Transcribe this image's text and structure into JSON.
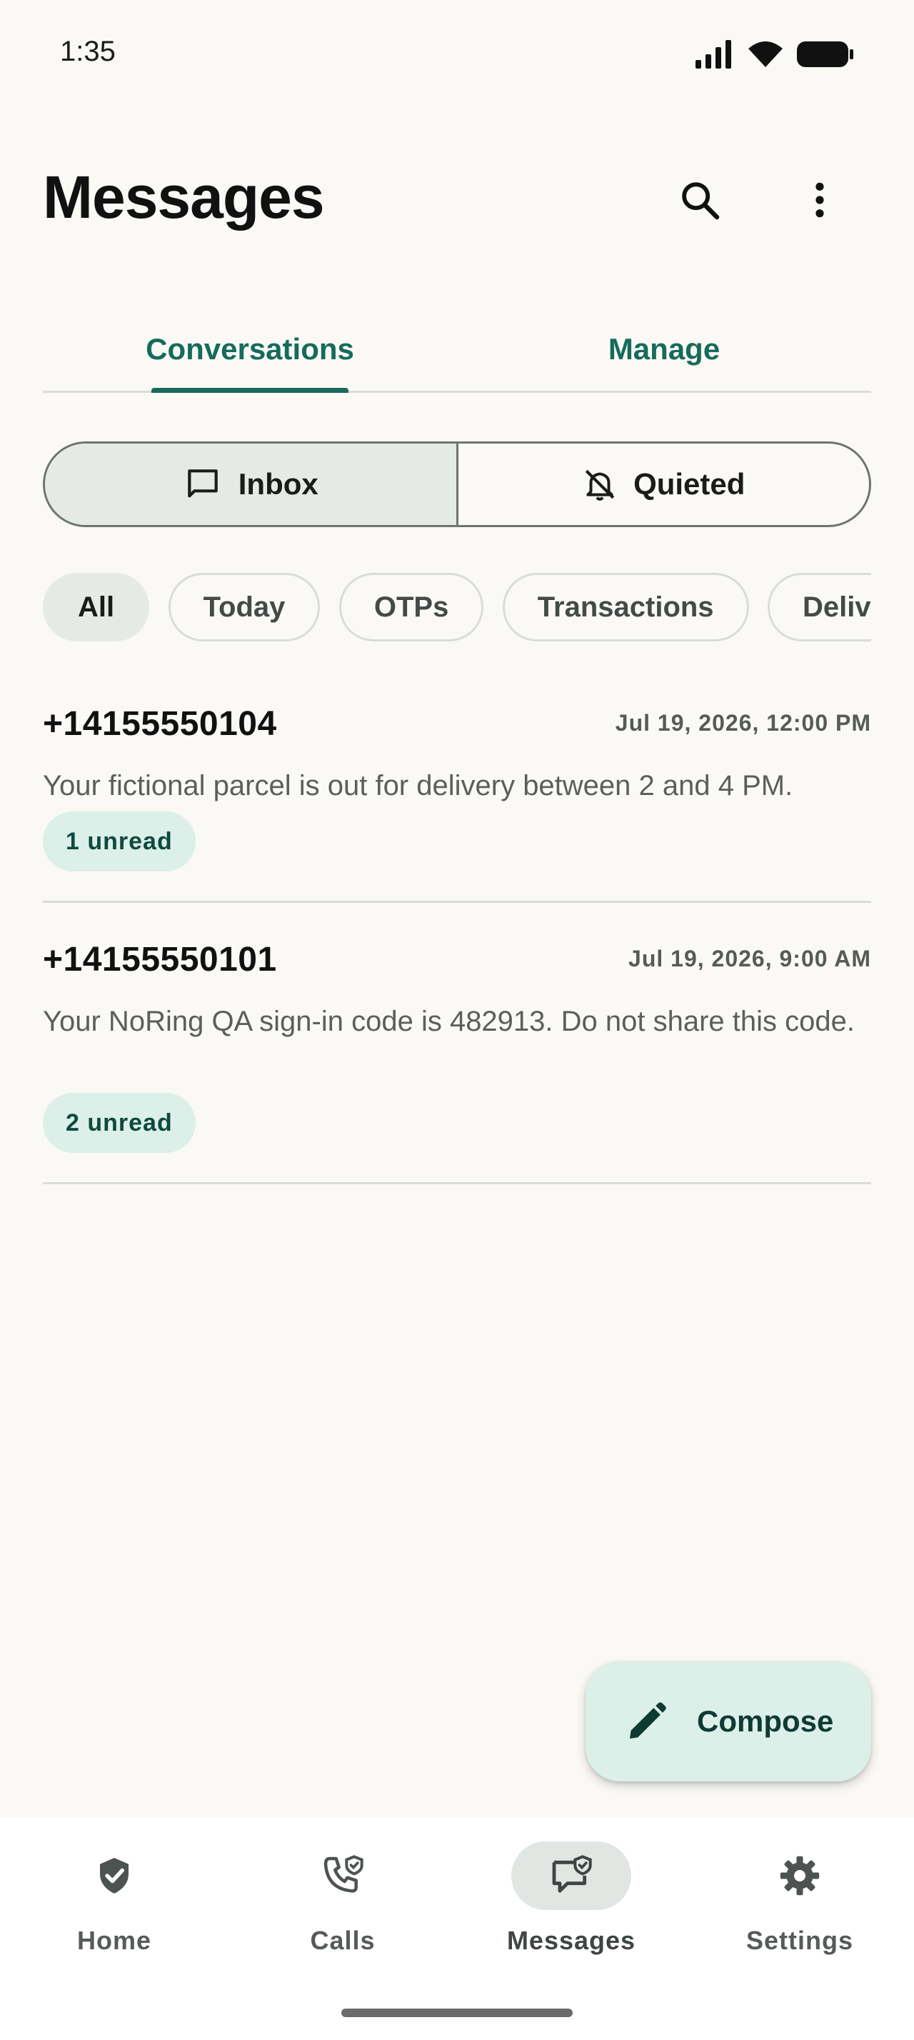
{
  "status_bar": {
    "time": "1:35"
  },
  "app_bar": {
    "title": "Messages"
  },
  "tabs": [
    {
      "label": "Conversations",
      "active": true
    },
    {
      "label": "Manage",
      "active": false
    }
  ],
  "segmented": [
    {
      "label": "Inbox",
      "icon": "message-outline-icon",
      "selected": true
    },
    {
      "label": "Quieted",
      "icon": "bell-off-icon",
      "selected": false
    }
  ],
  "chips": [
    {
      "label": "All",
      "selected": true
    },
    {
      "label": "Today",
      "selected": false
    },
    {
      "label": "OTPs",
      "selected": false
    },
    {
      "label": "Transactions",
      "selected": false
    },
    {
      "label": "Deliveries",
      "selected": false
    }
  ],
  "conversations": [
    {
      "number": "+14155550104",
      "time": "Jul 19, 2026, 12:00 PM",
      "preview": "Your fictional parcel is out for delivery between 2 and 4 PM.",
      "badge": "1 unread"
    },
    {
      "number": "+14155550101",
      "time": "Jul 19, 2026, 9:00 AM",
      "preview": "Your NoRing QA sign-in code is 482913. Do not share this code.",
      "badge": "2 unread"
    }
  ],
  "fab": {
    "label": "Compose",
    "icon": "pencil-icon"
  },
  "bottom_nav": [
    {
      "label": "Home",
      "icon": "shield-check-icon",
      "active": false
    },
    {
      "label": "Calls",
      "icon": "phone-shield-icon",
      "active": false
    },
    {
      "label": "Messages",
      "icon": "message-shield-icon",
      "active": true
    },
    {
      "label": "Settings",
      "icon": "gear-icon",
      "active": false
    }
  ],
  "colors": {
    "accent": "#166b5a",
    "background": "#faf9f6",
    "badge_bg": "#dcefe8",
    "selected_bg": "#e5eae6"
  }
}
